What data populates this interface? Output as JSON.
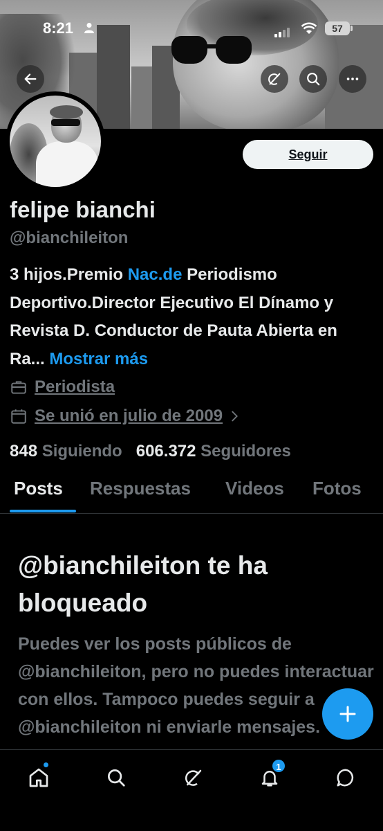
{
  "status_bar": {
    "time": "8:21",
    "battery": "57"
  },
  "header": {
    "back_icon": "arrow-left-icon",
    "grok_icon": "grok-icon",
    "search_icon": "search-icon",
    "more_icon": "more-icon"
  },
  "profile": {
    "follow_label": "Seguir",
    "name": "felipe bianchi",
    "handle": "@bianchileiton",
    "bio_part1": "3 hijos.Premio ",
    "bio_link": "Nac.de",
    "bio_part2": " Periodismo Deportivo.Director Ejecutivo El Dínamo y Revista D. Conductor de Pauta Abierta en Ra...",
    "show_more": "Mostrar más",
    "job": "Periodista",
    "joined": "Se unió en julio de 2009",
    "following_count": "848",
    "following_label": "Siguiendo",
    "followers_count": "606.372",
    "followers_label": "Seguidores"
  },
  "tabs": [
    {
      "label": "Posts",
      "active": true
    },
    {
      "label": "Respuestas",
      "active": false
    },
    {
      "label": "Videos",
      "active": false
    },
    {
      "label": "Fotos",
      "active": false
    }
  ],
  "blocked": {
    "title": "@bianchileiton te ha bloqueado",
    "body": "Puedes ver los posts públicos de @bianchileiton, pero no puedes interactuar con ellos. Tampoco puedes seguir a @bianchileiton ni enviarle mensajes."
  },
  "bottom_nav": {
    "notification_count": "1"
  },
  "colors": {
    "accent": "#1d9bf0",
    "muted": "#71767b",
    "text": "#e7e9ea"
  }
}
